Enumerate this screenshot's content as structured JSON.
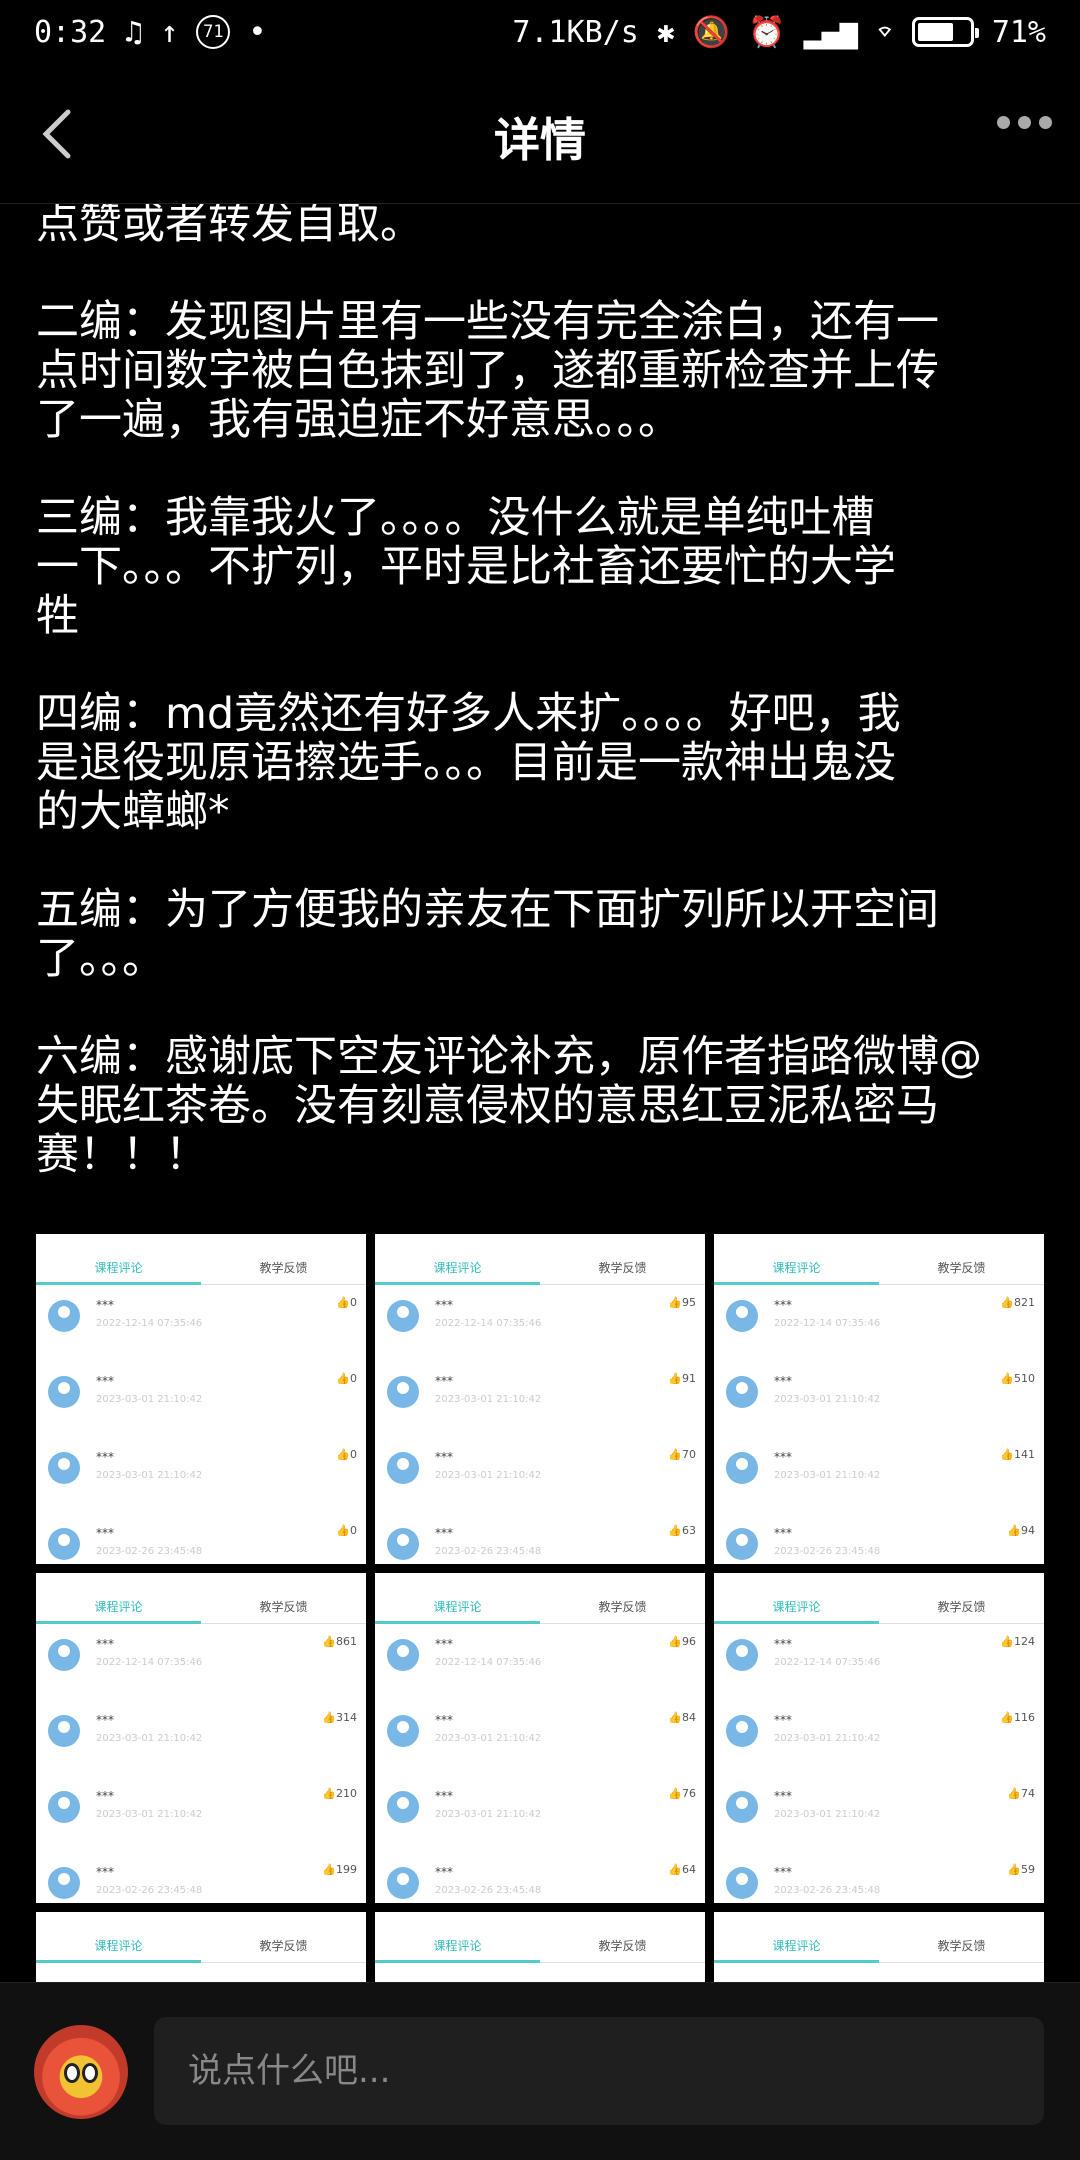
{
  "status_bar": {
    "time": "0:32",
    "badge": "71",
    "net_speed": "7.1KB/s",
    "battery": "71%"
  },
  "header": {
    "title": "详情"
  },
  "post": {
    "paragraphs": [
      "点赞或者转发自取。",
      "二编：发现图片里有一些没有完全涂白，还有一\n点时间数字被白色抹到了，遂都重新检查并上传\n了一遍，我有强迫症不好意思。。。",
      "三编：我靠我火了。。。。没什么就是单纯吐槽\n一下。。。不扩列，平时是比社畜还要忙的大学\n牲",
      "四编：md竟然还有好多人来扩。。。。好吧，我\n是退役现原语擦选手。。。目前是一款神出鬼没\n的大蟑螂*",
      "五编：为了方便我的亲友在下面扩列所以开空间\n了。。。",
      "六编：感谢底下空友评论补充，原作者指路微博@\n失眠红茶卷。没有刻意侵权的意思红豆泥私密马\n赛！！！"
    ]
  },
  "screenshots": [
    {
      "tab1": "课程评论",
      "tab2": "教学反馈",
      "rows": [
        {
          "name": "***",
          "time": "2022-12-14 07:35:46",
          "likes": "0"
        },
        {
          "name": "***",
          "time": "2023-03-01 21:10:42",
          "likes": "0"
        },
        {
          "name": "***",
          "time": "2023-03-01 21:10:42",
          "likes": "0"
        },
        {
          "name": "***",
          "time": "2023-02-26 23:45:48",
          "likes": "0"
        }
      ]
    },
    {
      "tab1": "课程评论",
      "tab2": "教学反馈",
      "rows": [
        {
          "name": "***",
          "time": "2022-12-14 07:35:46",
          "likes": "95"
        },
        {
          "name": "***",
          "time": "2023-03-01 21:10:42",
          "likes": "91"
        },
        {
          "name": "***",
          "time": "2023-03-01 21:10:42",
          "likes": "70"
        },
        {
          "name": "***",
          "time": "2023-02-26 23:45:48",
          "likes": "63"
        }
      ]
    },
    {
      "tab1": "课程评论",
      "tab2": "教学反馈",
      "rows": [
        {
          "name": "***",
          "time": "2022-12-14 07:35:46",
          "likes": "821"
        },
        {
          "name": "***",
          "time": "2023-03-01 21:10:42",
          "likes": "510"
        },
        {
          "name": "***",
          "time": "2023-03-01 21:10:42",
          "likes": "141"
        },
        {
          "name": "***",
          "time": "2023-02-26 23:45:48",
          "likes": "94"
        }
      ]
    },
    {
      "tab1": "课程评论",
      "tab2": "教学反馈",
      "rows": [
        {
          "name": "***",
          "time": "2022-12-14 07:35:46",
          "likes": "861"
        },
        {
          "name": "***",
          "time": "2023-03-01 21:10:42",
          "likes": "314"
        },
        {
          "name": "***",
          "time": "2023-03-01 21:10:42",
          "likes": "210"
        },
        {
          "name": "***",
          "time": "2023-02-26 23:45:48",
          "likes": "199"
        }
      ]
    },
    {
      "tab1": "课程评论",
      "tab2": "教学反馈",
      "rows": [
        {
          "name": "***",
          "time": "2022-12-14 07:35:46",
          "likes": "96"
        },
        {
          "name": "***",
          "time": "2023-03-01 21:10:42",
          "likes": "84"
        },
        {
          "name": "***",
          "time": "2023-03-01 21:10:42",
          "likes": "76"
        },
        {
          "name": "***",
          "time": "2023-02-26 23:45:48",
          "likes": "64"
        }
      ]
    },
    {
      "tab1": "课程评论",
      "tab2": "教学反馈",
      "rows": [
        {
          "name": "***",
          "time": "2022-12-14 07:35:46",
          "likes": "124"
        },
        {
          "name": "***",
          "time": "2023-03-01 21:10:42",
          "likes": "116"
        },
        {
          "name": "***",
          "time": "2023-03-01 21:10:42",
          "likes": "74"
        },
        {
          "name": "***",
          "time": "2023-02-26 23:45:48",
          "likes": "59"
        }
      ]
    },
    {
      "tab1": "课程评论",
      "tab2": "教学反馈",
      "rows": []
    },
    {
      "tab1": "课程评论",
      "tab2": "教学反馈",
      "rows": []
    },
    {
      "tab1": "课程评论",
      "tab2": "教学反馈",
      "rows": []
    }
  ],
  "comment_bar": {
    "placeholder": "说点什么吧..."
  }
}
